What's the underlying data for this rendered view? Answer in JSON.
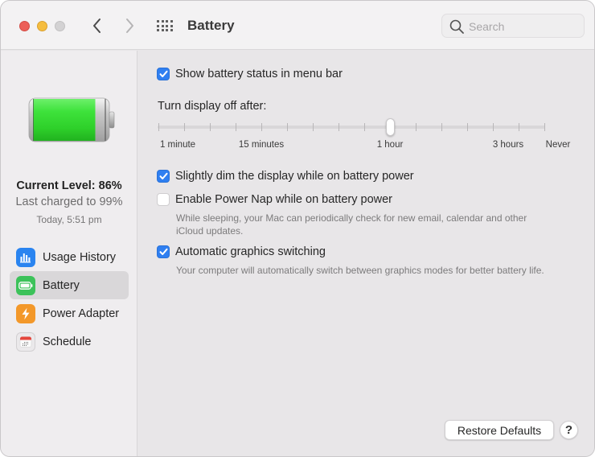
{
  "window": {
    "title": "Battery",
    "search": {
      "placeholder": "Search",
      "value": ""
    }
  },
  "colors": {
    "accent": "#2f7ff1",
    "battery_green": "#3dd63d",
    "close": "#ec5f58",
    "minimize": "#f5bd3f",
    "zoom_disabled": "#d3d2d3"
  },
  "sidebar": {
    "status": {
      "current_level": "Current Level: 86%",
      "last_charged": "Last charged to 99%",
      "charged_time": "Today, 5:51 pm"
    },
    "battery_level_percent": 86,
    "items": [
      {
        "label": "Usage History",
        "icon": "usage-history-icon",
        "color": "#2a84f0",
        "selected": false
      },
      {
        "label": "Battery",
        "icon": "battery-icon",
        "color": "#3cc25a",
        "selected": true
      },
      {
        "label": "Power Adapter",
        "icon": "power-adapter-icon",
        "color": "#f3982a",
        "selected": false
      },
      {
        "label": "Schedule",
        "icon": "calendar-icon",
        "color": "#ebe9eb",
        "selected": false
      }
    ]
  },
  "main": {
    "show_status": {
      "label": "Show battery status in menu bar",
      "checked": true
    },
    "display_off": {
      "label": "Turn display off after:",
      "positions": 16,
      "selected_index": 9,
      "selected_value": "1 hour",
      "tick_labels": [
        {
          "text": "1 minute",
          "index": 0
        },
        {
          "text": "15 minutes",
          "index": 4
        },
        {
          "text": "1 hour",
          "index": 9
        },
        {
          "text": "3 hours",
          "index": 14
        },
        {
          "text": "Never",
          "index": 15
        }
      ]
    },
    "dim_display": {
      "label": "Slightly dim the display while on battery power",
      "checked": true
    },
    "power_nap": {
      "label": "Enable Power Nap while on battery power",
      "checked": false,
      "description_line1": "While sleeping, your Mac can periodically check for new email, calendar and other",
      "description_line2": "iCloud updates."
    },
    "graphics_switching": {
      "label": "Automatic graphics switching",
      "checked": true,
      "description": "Your computer will automatically switch between graphics modes for better battery life."
    },
    "restore_defaults": "Restore Defaults",
    "help": "?"
  }
}
